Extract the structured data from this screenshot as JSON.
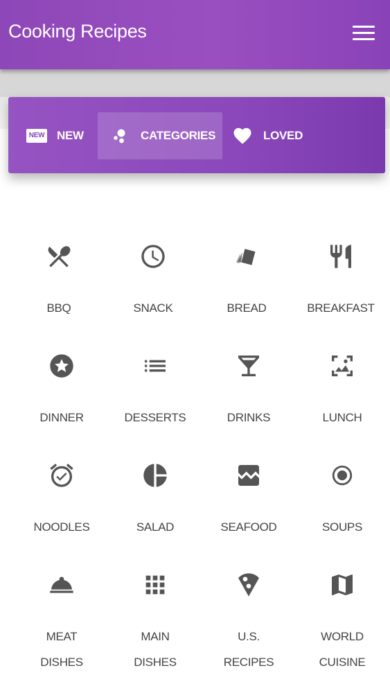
{
  "app": {
    "title": "Cooking Recipes"
  },
  "tabs": {
    "new_badge": "NEW",
    "new": "NEW",
    "categories": "CATEGORIES",
    "loved": "LOVED"
  },
  "categories": [
    {
      "label": "BBQ",
      "icon": "restaurant-icon"
    },
    {
      "label": "SNACK",
      "icon": "clock-icon"
    },
    {
      "label": "BREAD",
      "icon": "cards-icon"
    },
    {
      "label": "BREAKFAST",
      "icon": "fork-knife-icon"
    },
    {
      "label": "DINNER",
      "icon": "star-circle-icon"
    },
    {
      "label": "DESSERTS",
      "icon": "list-icon"
    },
    {
      "label": "DRINKS",
      "icon": "cocktail-icon"
    },
    {
      "label": "LUNCH",
      "icon": "photo-frame-icon"
    },
    {
      "label": "NOODLES",
      "icon": "alarm-icon"
    },
    {
      "label": "SALAD",
      "icon": "pie-chart-icon"
    },
    {
      "label": "SEAFOOD",
      "icon": "image-icon"
    },
    {
      "label": "SOUPS",
      "icon": "radio-button-icon"
    },
    {
      "label": "MEAT",
      "label2": "DISHES",
      "icon": "cloche-icon"
    },
    {
      "label": "MAIN",
      "label2": "DISHES",
      "icon": "apps-grid-icon"
    },
    {
      "label": "U.S.",
      "label2": "RECIPES",
      "icon": "pizza-icon"
    },
    {
      "label": "WORLD",
      "label2": "CUISINE",
      "icon": "map-icon"
    }
  ],
  "colors": {
    "primary": "#8e47b8",
    "icon": "#555555",
    "text": "#444444"
  }
}
